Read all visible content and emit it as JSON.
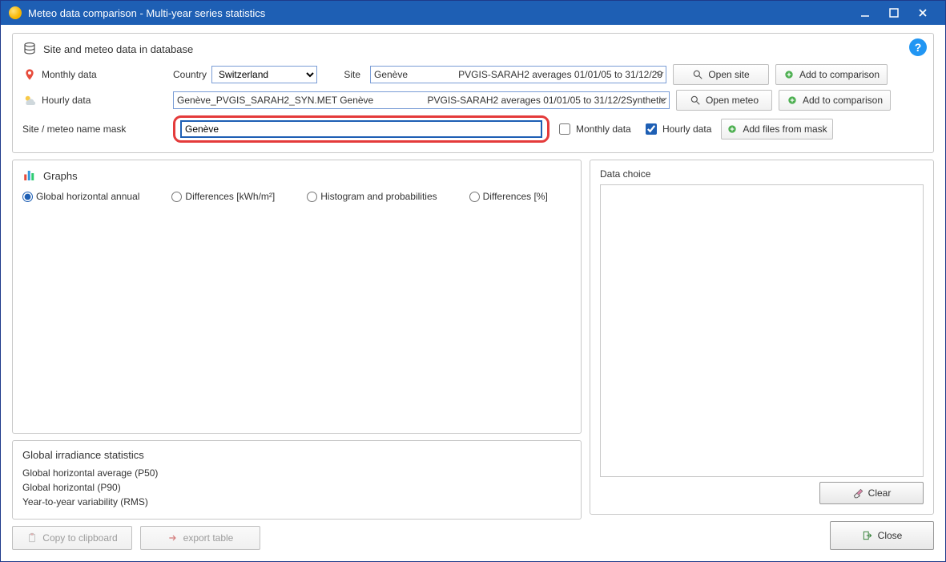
{
  "title": "Meteo data comparison - Multi-year series statistics",
  "section_db": {
    "header": "Site and meteo data in database",
    "monthly_label": "Monthly data",
    "country_label": "Country",
    "country_value": "Switzerland",
    "site_label": "Site",
    "site_value_left": "Genève",
    "site_value_right": "PVGIS-SARAH2 averages 01/01/05 to 31/12/20",
    "open_site": "Open site",
    "add_compare": "Add to comparison",
    "hourly_label": "Hourly data",
    "hourly_value_left": "Genève_PVGIS_SARAH2_SYN.MET    Genève",
    "hourly_value_right": "PVGIS-SARAH2 averages 01/01/05 to 31/12/2Synthetic",
    "open_meteo": "Open meteo",
    "mask_label": "Site / meteo name mask",
    "mask_value": "Genève",
    "chk_monthly": "Monthly data",
    "chk_hourly": "Hourly data",
    "add_mask": "Add files from mask"
  },
  "graphs": {
    "header": "Graphs",
    "r1": "Global horizontal annual",
    "r2": "Differences [kWh/m²]",
    "r3": "Histogram and probabilities",
    "r4": "Differences [%]"
  },
  "stats": {
    "header": "Global irradiance statistics",
    "l1": "Global horizontal average (P50)",
    "l2": "Global horizontal (P90)",
    "l3": "Year-to-year variability (RMS)"
  },
  "footer": {
    "copy": "Copy to clipboard",
    "export": "export table"
  },
  "right": {
    "header": "Data choice",
    "clear": "Clear",
    "close": "Close"
  }
}
